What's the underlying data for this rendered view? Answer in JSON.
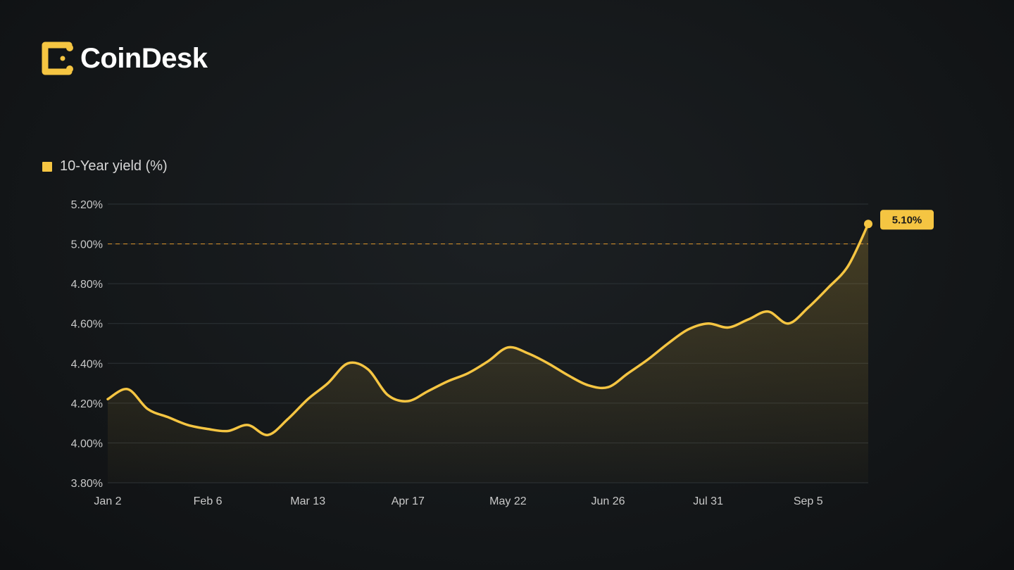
{
  "brand": {
    "name": "CoinDesk",
    "icon": "coindesk-logo-icon",
    "accent": "#f5c542"
  },
  "chart_data": {
    "type": "line",
    "title": "",
    "xlabel": "",
    "ylabel": "",
    "ylim": [
      3.8,
      5.2
    ],
    "yticks": [
      5.2,
      5.0,
      4.8,
      4.6,
      4.4,
      4.2,
      4.0,
      3.8
    ],
    "ytick_labels": [
      "5.20%",
      "5.00%",
      "4.80%",
      "4.60%",
      "4.40%",
      "4.20%",
      "4.00%",
      "3.80%"
    ],
    "xtick_labels": [
      "Jan 2",
      "Feb 6",
      "Mar 13",
      "Apr 17",
      "May 22",
      "Jun 26",
      "Jul 31",
      "Sep 5"
    ],
    "grid": true,
    "legend_position": "top-left",
    "reference_line": {
      "y": 5.0,
      "style": "dashed"
    },
    "callout": {
      "label": "5.10%",
      "value": 5.1
    },
    "series": [
      {
        "name": "10-Year yield (%)",
        "color": "#f5c542",
        "x": [
          "Jan 2",
          "Jan 9",
          "Jan 16",
          "Jan 23",
          "Jan 30",
          "Feb 6",
          "Feb 13",
          "Feb 20",
          "Feb 27",
          "Mar 6",
          "Mar 13",
          "Mar 20",
          "Mar 27",
          "Apr 3",
          "Apr 10",
          "Apr 17",
          "Apr 24",
          "May 1",
          "May 8",
          "May 15",
          "May 22",
          "May 29",
          "Jun 5",
          "Jun 12",
          "Jun 19",
          "Jun 26",
          "Jul 3",
          "Jul 10",
          "Jul 17",
          "Jul 24",
          "Jul 31",
          "Aug 7",
          "Aug 14",
          "Aug 21",
          "Aug 28",
          "Sep 5",
          "Sep 12",
          "Sep 19"
        ],
        "values": [
          4.22,
          4.27,
          4.17,
          4.13,
          4.09,
          4.07,
          4.06,
          4.09,
          4.04,
          4.12,
          4.22,
          4.3,
          4.4,
          4.37,
          4.24,
          4.21,
          4.26,
          4.31,
          4.35,
          4.41,
          4.48,
          4.45,
          4.4,
          4.34,
          4.29,
          4.28,
          4.35,
          4.42,
          4.5,
          4.57,
          4.6,
          4.58,
          4.62,
          4.66,
          4.6,
          4.68,
          4.78,
          4.89
        ]
      }
    ]
  }
}
